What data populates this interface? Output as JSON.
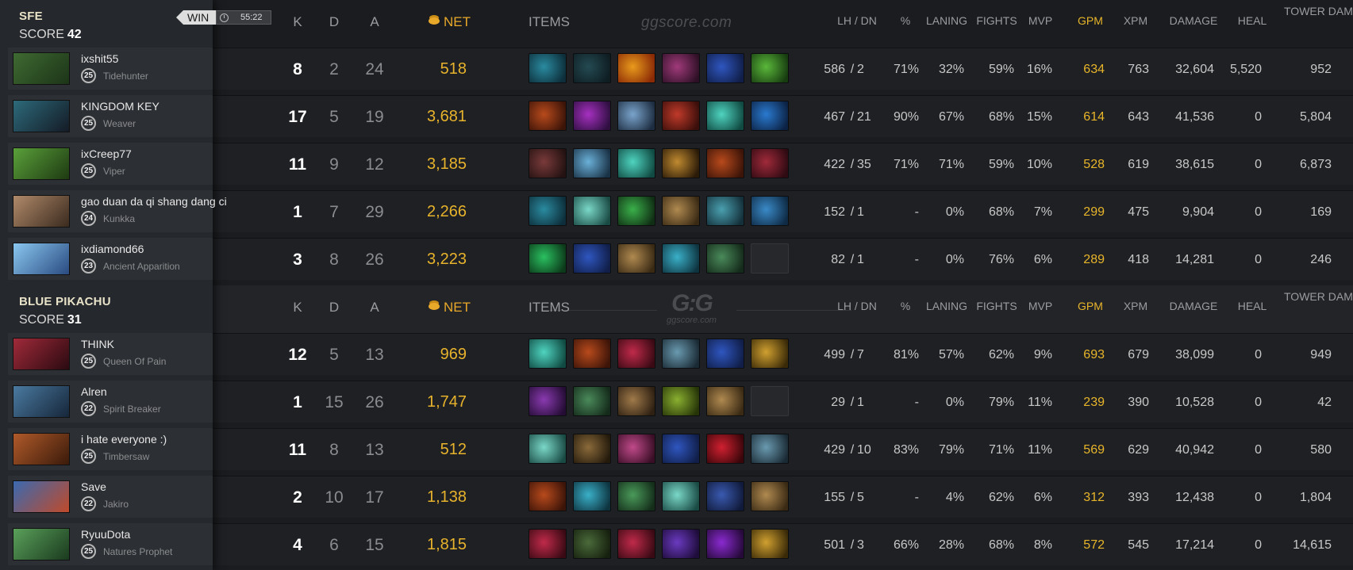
{
  "header": {
    "k": "K",
    "d": "D",
    "a": "A",
    "net": "NET",
    "items": "ITEMS",
    "lh_dn": "LH  /  DN",
    "pct": "%",
    "laning": "LANING",
    "fights": "FIGHTS",
    "mvp": "MVP",
    "gpm": "GPM",
    "xpm": "XPM",
    "damage": "DAMAGE",
    "heal": "HEAL",
    "tower": "TOWER DAMAGE",
    "brand": "ggscore.com",
    "brand_logo": "G:G",
    "brand_logo_sub": "ggscore.com"
  },
  "result": {
    "label": "WIN",
    "time": "55:22"
  },
  "colors": {
    "gold": "#e8b52a",
    "panel": "#25282c",
    "bg": "#1a1c1f"
  },
  "teams": [
    {
      "name": "SFE",
      "score_label": "SCORE",
      "score": "42",
      "players": [
        {
          "name": "ixshit55",
          "level": "25",
          "hero": "Tidehunter",
          "portrait": [
            "#3f6a32",
            "#1c3418"
          ],
          "k": "8",
          "d": "2",
          "a": "24",
          "net": "518",
          "lh": "586",
          "dn": "2",
          "pct": "71%",
          "laning": "32%",
          "fights": "59%",
          "mvp": "16%",
          "gpm": "634",
          "xpm": "763",
          "damage": "32,604",
          "heal": "5,520",
          "tower": "952",
          "items": [
            [
              "#2a8ba0",
              "#0d2e3a"
            ],
            [
              "#244a52",
              "#0e1d22"
            ],
            [
              "#e99a1c",
              "#8a2a06"
            ],
            [
              "#a03a7a",
              "#2e1026"
            ],
            [
              "#2f56c0",
              "#101e48"
            ],
            [
              "#5ab83a",
              "#173c10"
            ]
          ]
        },
        {
          "name": "KINGDOM KEY",
          "level": "25",
          "hero": "Weaver",
          "portrait": [
            "#2d6a7a",
            "#141b26"
          ],
          "k": "17",
          "d": "5",
          "a": "19",
          "net": "3,681",
          "lh": "467",
          "dn": "21",
          "pct": "90%",
          "laning": "67%",
          "fights": "68%",
          "mvp": "15%",
          "gpm": "614",
          "xpm": "643",
          "damage": "41,536",
          "heal": "0",
          "tower": "5,804",
          "items": [
            [
              "#b84a1c",
              "#3c1408"
            ],
            [
              "#a630c0",
              "#2e0f40"
            ],
            [
              "#7aa4cc",
              "#1e2e42"
            ],
            [
              "#c03a2a",
              "#3a0e0a"
            ],
            [
              "#4fd4c0",
              "#104a42"
            ],
            [
              "#2a7ad0",
              "#0c2244"
            ]
          ]
        },
        {
          "name": "ixCreep77",
          "level": "25",
          "hero": "Viper",
          "portrait": [
            "#5aa03a",
            "#1e3a12"
          ],
          "k": "11",
          "d": "9",
          "a": "12",
          "net": "3,185",
          "lh": "422",
          "dn": "35",
          "pct": "71%",
          "laning": "71%",
          "fights": "59%",
          "mvp": "10%",
          "gpm": "528",
          "xpm": "619",
          "damage": "38,615",
          "heal": "0",
          "tower": "6,873",
          "items": [
            [
              "#7a3a3a",
              "#241212"
            ],
            [
              "#6ab0d8",
              "#1a3246"
            ],
            [
              "#4fd4c0",
              "#104a42"
            ],
            [
              "#c08a30",
              "#2a1a08"
            ],
            [
              "#b84a1c",
              "#3c1408"
            ],
            [
              "#a02a3a",
              "#2e0a12"
            ]
          ]
        },
        {
          "name": "gao duan da qi shang dang ci",
          "level": "24",
          "hero": "Kunkka",
          "portrait": [
            "#b08a6a",
            "#3a2a1e"
          ],
          "k": "1",
          "d": "7",
          "a": "29",
          "net": "2,266",
          "lh": "152",
          "dn": "1",
          "pct": "-",
          "laning": "0%",
          "fights": "68%",
          "mvp": "7%",
          "gpm": "299",
          "xpm": "475",
          "damage": "9,904",
          "heal": "0",
          "tower": "169",
          "items": [
            [
              "#2a8ba0",
              "#0d2e3a"
            ],
            [
              "#7ad8c8",
              "#1a4a44"
            ],
            [
              "#3ab04a",
              "#102e14"
            ],
            [
              "#b08a50",
              "#3a2a14"
            ],
            [
              "#4aa0b0",
              "#14303a"
            ],
            [
              "#3a8ac8",
              "#0e2a44"
            ]
          ]
        },
        {
          "name": "ixdiamond66",
          "level": "23",
          "hero": "Ancient Apparition",
          "portrait": [
            "#8ac8f0",
            "#2a4a80"
          ],
          "k": "3",
          "d": "8",
          "a": "26",
          "net": "3,223",
          "lh": "82",
          "dn": "1",
          "pct": "-",
          "laning": "0%",
          "fights": "76%",
          "mvp": "6%",
          "gpm": "289",
          "xpm": "418",
          "damage": "14,281",
          "heal": "0",
          "tower": "246",
          "items": [
            [
              "#2ac060",
              "#0c3a1a"
            ],
            [
              "#2f56c0",
              "#101e48"
            ],
            [
              "#b08a50",
              "#3a2a14"
            ],
            [
              "#3ab0c8",
              "#0e3440"
            ],
            [
              "#4a8a5a",
              "#142a1a"
            ],
            [
              "empty",
              "empty"
            ]
          ]
        }
      ]
    },
    {
      "name": "BLUE PIKACHU",
      "score_label": "SCORE",
      "score": "31",
      "players": [
        {
          "name": "THINK",
          "level": "25",
          "hero": "Queen Of Pain",
          "portrait": [
            "#a02a3a",
            "#2a0a10"
          ],
          "k": "12",
          "d": "5",
          "a": "13",
          "net": "969",
          "lh": "499",
          "dn": "7",
          "pct": "81%",
          "laning": "57%",
          "fights": "62%",
          "mvp": "9%",
          "gpm": "693",
          "xpm": "679",
          "damage": "38,099",
          "heal": "0",
          "tower": "949",
          "items": [
            [
              "#4fd4c0",
              "#104a42"
            ],
            [
              "#b84a1c",
              "#3c1408"
            ],
            [
              "#c02a4a",
              "#3a0a14"
            ],
            [
              "#6a9ab0",
              "#1a2a34"
            ],
            [
              "#2f56c0",
              "#101e48"
            ],
            [
              "#d0a030",
              "#3a2a08"
            ]
          ]
        },
        {
          "name": "Alren",
          "level": "22",
          "hero": "Spirit Breaker",
          "portrait": [
            "#4a7aa0",
            "#16263a"
          ],
          "k": "1",
          "d": "15",
          "a": "26",
          "net": "1,747",
          "lh": "29",
          "dn": "1",
          "pct": "-",
          "laning": "0%",
          "fights": "79%",
          "mvp": "11%",
          "gpm": "239",
          "xpm": "390",
          "damage": "10,528",
          "heal": "0",
          "tower": "42",
          "items": [
            [
              "#8a3ab0",
              "#240c34"
            ],
            [
              "#4a8a5a",
              "#142a1a"
            ],
            [
              "#a07a4a",
              "#2e2012"
            ],
            [
              "#8ab030",
              "#263408"
            ],
            [
              "#b08a50",
              "#3a2a14"
            ],
            [
              "empty",
              "empty"
            ]
          ]
        },
        {
          "name": "i hate everyone :)",
          "level": "25",
          "hero": "Timbersaw",
          "portrait": [
            "#b05a2a",
            "#3a1a0a"
          ],
          "k": "11",
          "d": "8",
          "a": "13",
          "net": "512",
          "lh": "429",
          "dn": "10",
          "pct": "83%",
          "laning": "79%",
          "fights": "71%",
          "mvp": "11%",
          "gpm": "569",
          "xpm": "629",
          "damage": "40,942",
          "heal": "0",
          "tower": "580",
          "items": [
            [
              "#7ad8c8",
              "#1a4a44"
            ],
            [
              "#8a6a3a",
              "#241a0c"
            ],
            [
              "#c04a8a",
              "#3a0e26"
            ],
            [
              "#2f56c0",
              "#101e48"
            ],
            [
              "#d02030",
              "#3a060a"
            ],
            [
              "#6a9ab0",
              "#1a2a34"
            ]
          ]
        },
        {
          "name": "Save",
          "level": "22",
          "hero": "Jakiro",
          "portrait": [
            "#3a6ab0",
            "#c04a2a"
          ],
          "k": "2",
          "d": "10",
          "a": "17",
          "net": "1,138",
          "lh": "155",
          "dn": "5",
          "pct": "-",
          "laning": "4%",
          "fights": "62%",
          "mvp": "6%",
          "gpm": "312",
          "xpm": "393",
          "damage": "12,438",
          "heal": "0",
          "tower": "1,804",
          "items": [
            [
              "#b84a1c",
              "#3c1408"
            ],
            [
              "#3ab0c8",
              "#0e3440"
            ],
            [
              "#4a9a5a",
              "#142e1a"
            ],
            [
              "#7ad8c8",
              "#1a4a44"
            ],
            [
              "#3a5ab0",
              "#101a3a"
            ],
            [
              "#b08a50",
              "#3a2a14"
            ]
          ]
        },
        {
          "name": "RyuuDota",
          "level": "25",
          "hero": "Natures Prophet",
          "portrait": [
            "#5aa05a",
            "#1a3a1e"
          ],
          "k": "4",
          "d": "6",
          "a": "15",
          "net": "1,815",
          "lh": "501",
          "dn": "3",
          "pct": "66%",
          "laning": "28%",
          "fights": "68%",
          "mvp": "8%",
          "gpm": "572",
          "xpm": "545",
          "damage": "17,214",
          "heal": "0",
          "tower": "14,615",
          "items": [
            [
              "#c02a4a",
              "#3a0a14"
            ],
            [
              "#4a6a3a",
              "#16200e"
            ],
            [
              "#c02a4a",
              "#3a0a14"
            ],
            [
              "#6a3ac0",
              "#1e0c3a"
            ],
            [
              "#8a2ad0",
              "#260a3a"
            ],
            [
              "#d0a030",
              "#3a2a08"
            ]
          ]
        }
      ]
    }
  ]
}
